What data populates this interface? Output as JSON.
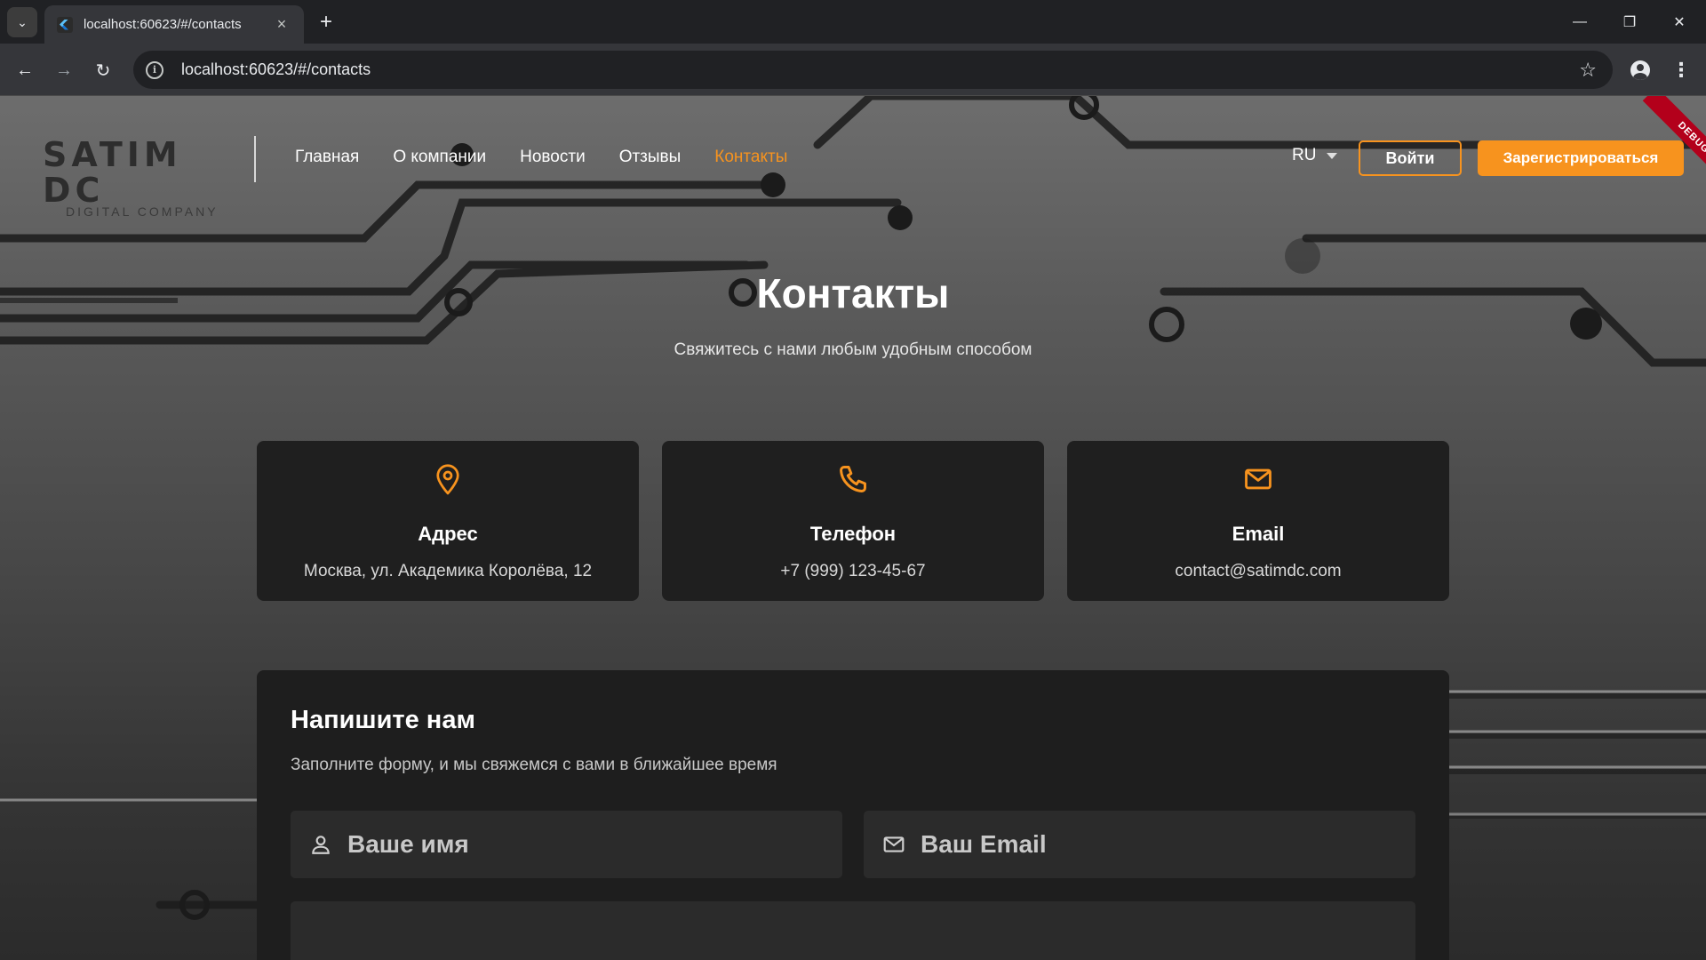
{
  "browser": {
    "tab_title": "localhost:60623/#/contacts",
    "url": "localhost:60623/#/contacts"
  },
  "header": {
    "logo_main": "SATIM DC",
    "logo_sub": "DIGITAL COMPANY",
    "nav": [
      {
        "label": "Главная",
        "active": false
      },
      {
        "label": "О компании",
        "active": false
      },
      {
        "label": "Новости",
        "active": false
      },
      {
        "label": "Отзывы",
        "active": false
      },
      {
        "label": "Контакты",
        "active": true
      }
    ],
    "language": "RU",
    "login_label": "Войти",
    "register_label": "Зарегистрироваться",
    "debug_banner": "DEBUG"
  },
  "hero": {
    "title": "Контакты",
    "subtitle": "Свяжитесь с нами любым удобным способом"
  },
  "cards": [
    {
      "icon": "location-pin-icon",
      "title": "Адрес",
      "value": "Москва, ул. Академика Королёва, 12"
    },
    {
      "icon": "phone-icon",
      "title": "Телефон",
      "value": "+7 (999) 123-45-67"
    },
    {
      "icon": "mail-icon",
      "title": "Email",
      "value": "contact@satimdc.com"
    }
  ],
  "form": {
    "title": "Напишите нам",
    "subtitle": "Заполните форму, и мы свяжемся с вами в ближайшее время",
    "name_placeholder": "Ваше имя",
    "email_placeholder": "Ваш Email"
  },
  "colors": {
    "accent": "#f7931e",
    "card_bg": "#1f1f1f",
    "debug_banner": "#b3001b"
  }
}
